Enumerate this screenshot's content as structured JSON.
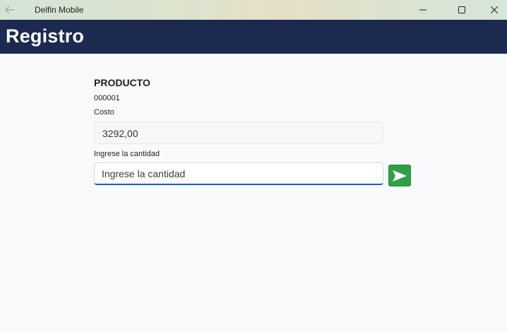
{
  "titlebar": {
    "app_title": "Delfin Mobile",
    "back_icon": "back-arrow-icon",
    "controls": [
      "minimize-icon",
      "maximize-icon",
      "close-icon"
    ]
  },
  "header": {
    "title": "Registro",
    "background_color": "#1c2a50"
  },
  "form": {
    "product_label": "PRODUCTO",
    "product_code": "000001",
    "cost_label": "Costo",
    "cost_value": "3292,00",
    "quantity_label": "Ingrese la cantidad",
    "quantity_value": "",
    "quantity_placeholder": "Ingrese la cantidad",
    "send_icon": "send-arrow-icon",
    "send_color": "#2ea043"
  }
}
